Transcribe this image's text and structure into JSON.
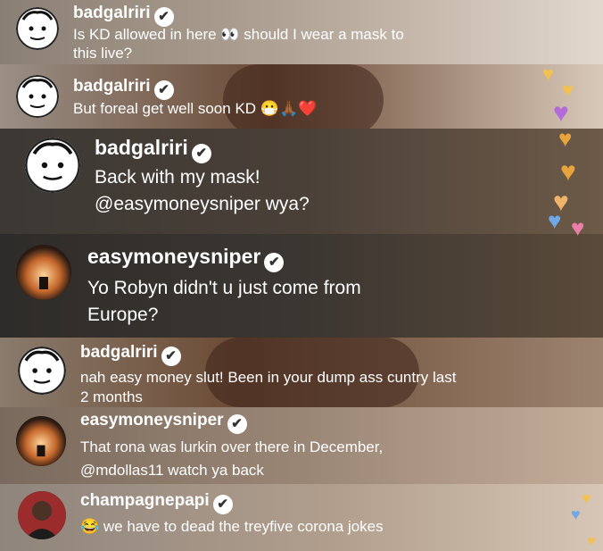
{
  "comments": [
    {
      "username": "badgalriri",
      "text1": "Is KD allowed in here 👀 should I wear a mask to",
      "text2": "this live?",
      "avatar": "cartoon-face-icon"
    },
    {
      "username": "badgalriri",
      "text1": "But foreal get well soon KD 😷🙏🏾❤️",
      "avatar": "cartoon-face-icon"
    },
    {
      "username": "badgalriri",
      "text1": "Back with my mask!",
      "text2": "@easymoneysniper wya?",
      "avatar": "cartoon-face-icon"
    },
    {
      "username": "easymoneysniper",
      "text1": "Yo Robyn didn't u just come from",
      "text2": "Europe?",
      "avatar": "sunset-avatar-icon"
    },
    {
      "username": "badgalriri",
      "text1": "nah easy money slut! Been in your dump ass cuntry last",
      "text2": "2 months",
      "avatar": "cartoon-face-icon"
    },
    {
      "username": "easymoneysniper",
      "text1": "That rona was lurkin over there in December,",
      "text2": "@mdollas11 watch ya back",
      "avatar": "sunset-avatar-icon"
    },
    {
      "username": "champagnepapi",
      "text1": "😂 we have to dead the treyfive corona jokes",
      "avatar": "profile-photo-icon"
    }
  ],
  "verified_glyph": "✔",
  "heart_colors": [
    "#f2c14e",
    "#e8a33d",
    "#b36bd9",
    "#e77fa8",
    "#6ea8e6",
    "#f0b36a"
  ]
}
